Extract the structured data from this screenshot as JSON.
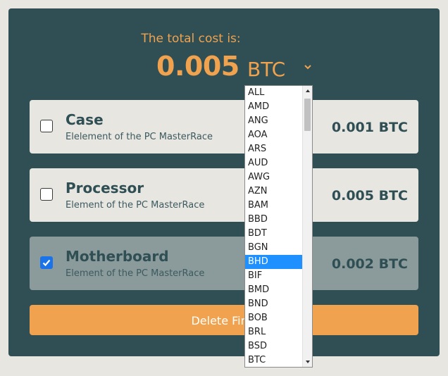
{
  "header": {
    "total_label": "The total cost is:",
    "total_amount": "0.005",
    "currency": "BTC",
    "currency_dropdown_icon": "chevron-down-icon"
  },
  "items": [
    {
      "name": "Case",
      "subtitle": "Elelement of the PC MasterRace",
      "price": "0.001 BTC",
      "checked": false
    },
    {
      "name": "Processor",
      "subtitle": "Element of the PC MasterRace",
      "price": "0.005 BTC",
      "checked": false
    },
    {
      "name": "Motherboard",
      "subtitle": "Element of the PC MasterRace",
      "price": "0.002 BTC",
      "checked": true
    }
  ],
  "delete_button": {
    "label": "Delete Finis"
  },
  "currency_options": [
    "ALL",
    "AMD",
    "ANG",
    "AOA",
    "ARS",
    "AUD",
    "AWG",
    "AZN",
    "BAM",
    "BBD",
    "BDT",
    "BGN",
    "BHD",
    "BIF",
    "BMD",
    "BND",
    "BOB",
    "BRL",
    "BSD",
    "BTC"
  ],
  "currency_selected": "BHD",
  "colors": {
    "panel": "#2f4f54",
    "accent": "#f0a24e",
    "card": "#e8e6e1",
    "card_checked": "#8b9a9a",
    "selection": "#1e90ff"
  }
}
